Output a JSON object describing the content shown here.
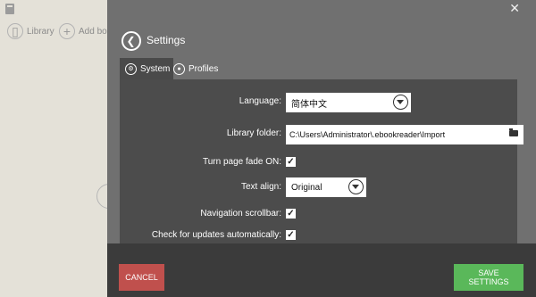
{
  "background": {
    "library_label": "Library",
    "add_book_label": "Add boo"
  },
  "panel": {
    "close_glyph": "✕",
    "title": "Settings",
    "tabs": [
      {
        "label": "System",
        "icon": "cog-icon",
        "active": true
      },
      {
        "label": "Profiles",
        "icon": "user-icon",
        "active": false
      }
    ]
  },
  "settings": {
    "language": {
      "label": "Language:",
      "value": "简体中文"
    },
    "library_folder": {
      "label": "Library folder:",
      "value": "C:\\Users\\Administrator\\.ebookreader\\Import"
    },
    "turn_page_fade": {
      "label": "Turn page fade ON:",
      "checked": true
    },
    "text_align": {
      "label": "Text align:",
      "value": "Original"
    },
    "navigation_scrollbar": {
      "label": "Navigation scrollbar:",
      "checked": true
    },
    "check_updates": {
      "label": "Check for updates automatically:",
      "checked": true
    }
  },
  "footer": {
    "cancel_label": "CANCEL",
    "save_label": "SAVE SETTINGS"
  },
  "colors": {
    "panel_bg": "#707070",
    "content_bg": "#4c4c4c",
    "footer_bg": "#3b3b3b",
    "cancel": "#c0504d",
    "save": "#5ab85a"
  }
}
